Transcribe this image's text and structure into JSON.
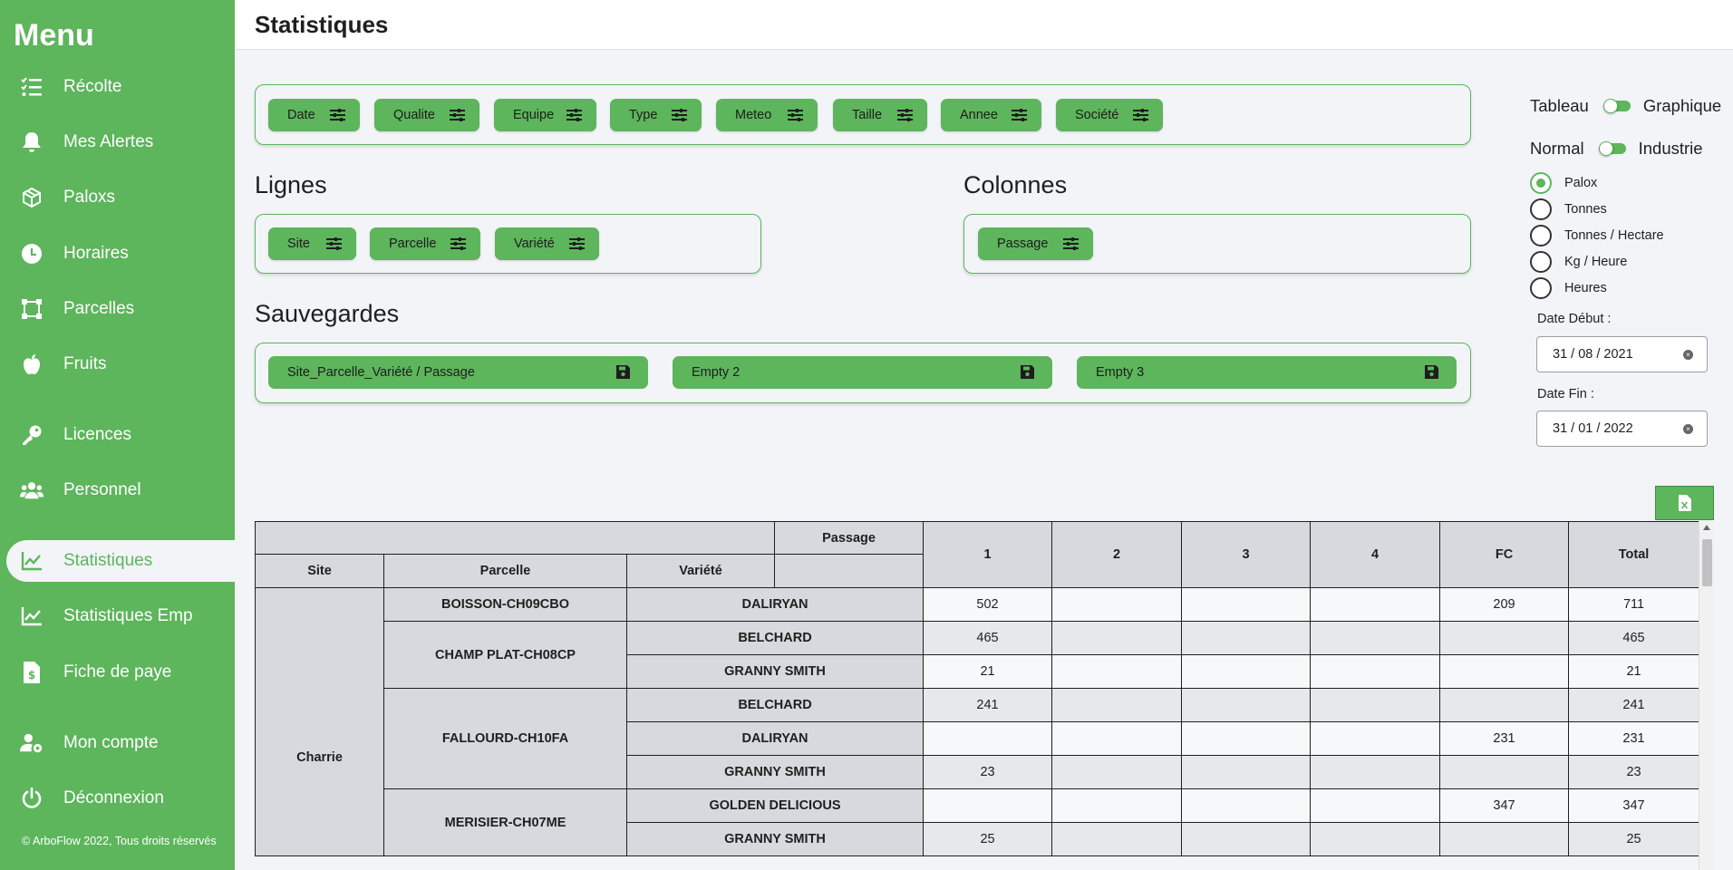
{
  "sidebar": {
    "title": "Menu",
    "items": [
      {
        "label": "Récolte",
        "icon": "checklist-icon"
      },
      {
        "label": "Mes Alertes",
        "icon": "bell-icon"
      },
      {
        "label": "Paloxs",
        "icon": "box-icon"
      },
      {
        "label": "Horaires",
        "icon": "clock-icon"
      },
      {
        "label": "Parcelles",
        "icon": "parcel-icon"
      },
      {
        "label": "Fruits",
        "icon": "apple-icon"
      },
      {
        "label": "Licences",
        "icon": "key-icon"
      },
      {
        "label": "Personnel",
        "icon": "people-icon"
      },
      {
        "label": "Statistiques",
        "icon": "chart-icon"
      },
      {
        "label": "Statistiques Emp",
        "icon": "chart-icon"
      },
      {
        "label": "Fiche de paye",
        "icon": "invoice-icon"
      },
      {
        "label": "Mon compte",
        "icon": "user-gear-icon"
      },
      {
        "label": "Déconnexion",
        "icon": "power-icon"
      }
    ],
    "footer": "© ArboFlow 2022, Tous droits réservés"
  },
  "header": {
    "title": "Statistiques"
  },
  "filters": [
    "Date",
    "Qualite",
    "Equipe",
    "Type",
    "Meteo",
    "Taille",
    "Annee",
    "Société"
  ],
  "lignes": {
    "label": "Lignes",
    "chips": [
      "Site",
      "Parcelle",
      "Variété"
    ]
  },
  "colonnes": {
    "label": "Colonnes",
    "chips": [
      "Passage"
    ]
  },
  "sauvegardes": {
    "label": "Sauvegardes",
    "slots": [
      "Site_Parcelle_Variété / Passage",
      "Empty 2",
      "Empty 3"
    ]
  },
  "toggles": {
    "view": {
      "left": "Tableau",
      "right": "Graphique"
    },
    "mode": {
      "left": "Normal",
      "right": "Industrie"
    }
  },
  "units": {
    "options": [
      "Palox",
      "Tonnes",
      "Tonnes / Hectare",
      "Kg / Heure",
      "Heures"
    ],
    "selected": "Palox"
  },
  "dates": {
    "start_label": "Date Début :",
    "start_value": "31 / 08 / 2021",
    "end_label": "Date Fin :",
    "end_value": "31 / 01 / 2022"
  },
  "colors": {
    "accent": "#5db55c",
    "background": "#f2f4f8"
  },
  "table": {
    "passage_header": "Passage",
    "row_headers": [
      "Site",
      "Parcelle",
      "Variété"
    ],
    "columns": [
      "1",
      "2",
      "3",
      "4",
      "FC",
      "Total"
    ],
    "site": "Charrie",
    "parcelles": [
      {
        "name": "BOISSON-CH09CBO",
        "rows": [
          {
            "variete": "DALIRYAN",
            "values": [
              "502",
              "",
              "",
              "",
              "209",
              "711"
            ]
          }
        ]
      },
      {
        "name": "CHAMP PLAT-CH08CP",
        "rows": [
          {
            "variete": "BELCHARD",
            "values": [
              "465",
              "",
              "",
              "",
              "",
              "465"
            ]
          },
          {
            "variete": "GRANNY SMITH",
            "values": [
              "21",
              "",
              "",
              "",
              "",
              "21"
            ]
          }
        ]
      },
      {
        "name": "FALLOURD-CH10FA",
        "rows": [
          {
            "variete": "BELCHARD",
            "values": [
              "241",
              "",
              "",
              "",
              "",
              "241"
            ]
          },
          {
            "variete": "DALIRYAN",
            "values": [
              "",
              "",
              "",
              "",
              "231",
              "231"
            ]
          },
          {
            "variete": "GRANNY SMITH",
            "values": [
              "23",
              "",
              "",
              "",
              "",
              "23"
            ]
          }
        ]
      },
      {
        "name": "MERISIER-CH07ME",
        "rows": [
          {
            "variete": "GOLDEN DELICIOUS",
            "values": [
              "",
              "",
              "",
              "",
              "347",
              "347"
            ]
          },
          {
            "variete": "GRANNY SMITH",
            "values": [
              "25",
              "",
              "",
              "",
              "",
              "25"
            ]
          }
        ]
      }
    ]
  }
}
